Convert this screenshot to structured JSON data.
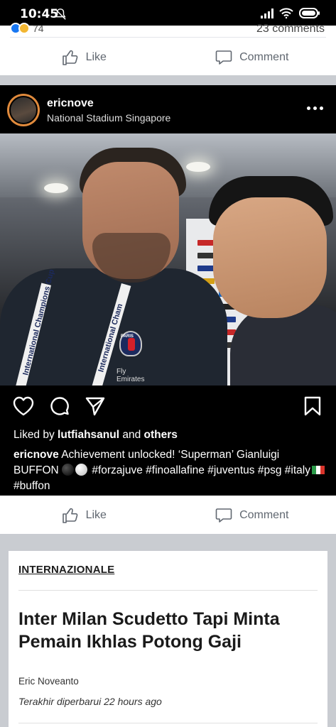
{
  "status_bar": {
    "time": "10:45",
    "battery_icon": "battery-icon",
    "wifi_icon": "wifi-icon",
    "signal_icon": "signal-icon",
    "mute_icon": "mute-icon"
  },
  "previous_post": {
    "reaction_count": "74",
    "comments": "23 comments",
    "like_label": "Like",
    "comment_label": "Comment"
  },
  "instagram_embed": {
    "username": "ericnove",
    "location": "National Stadium Singapore",
    "photo_texts": {
      "lanyard": "International Champions Cup",
      "lanyard_2": "International Cham",
      "badge_text": "PARIS",
      "shirt_text": "Fly Emirates"
    },
    "liked_by_prefix": "Liked by ",
    "liked_by_user": "lutfiahsanul",
    "liked_by_and": " and ",
    "liked_by_others": "others",
    "caption_user": "ericnove",
    "caption_text_1": " Achievement unlocked! ‘Superman’ Gianluigi BUFFON ",
    "caption_text_2": " #forzajuve #fino​allafine #juventus #psg #italy",
    "caption_text_3": " #buffon"
  },
  "post_actions": {
    "like_label": "Like",
    "comment_label": "Comment"
  },
  "article": {
    "category": "INTERNAZIONALE",
    "title": "Inter Milan Scudetto Tapi Minta Pemain Ikhlas Potong Gaji",
    "author": "Eric Noveanto",
    "updated": "Terakhir diperbarui 22 hours ago"
  },
  "colors": {
    "facebook_gray": "#c9ccd1",
    "instagram_bg": "#000000",
    "text_muted": "#606770"
  }
}
